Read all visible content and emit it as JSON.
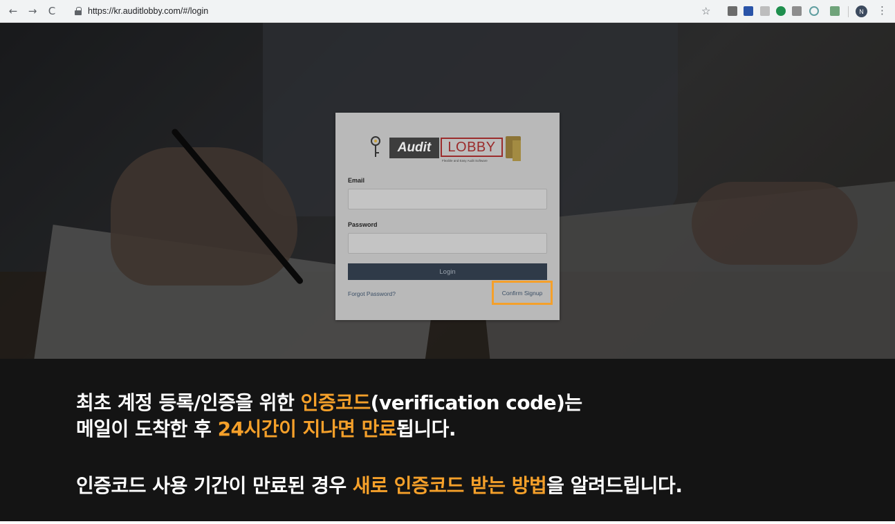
{
  "browser": {
    "back_icon": "arrow-left-icon",
    "forward_icon": "arrow-right-icon",
    "reload_icon": "reload-icon",
    "url": "https://kr.auditlobby.com/#/login",
    "profile_initial": "N"
  },
  "login": {
    "logo_audit": "Audit",
    "logo_lobby": "LOBBY",
    "logo_tagline": "Flexible and Easy Audit Software",
    "email_label": "Email",
    "password_label": "Password",
    "login_button": "Login",
    "forgot_link": "Forgot Password?",
    "confirm_link": "Confirm Signup",
    "highlight_color": "#f5a02a"
  },
  "caption": {
    "line1_a": "최초 계정 등록/인증을 위한 ",
    "line1_hl": "인증코드",
    "line1_b": "(verification code)는",
    "line2_a": "메일이 도착한 후 ",
    "line2_hl": "24시간이 지나면 만료",
    "line2_b": "됩니다.",
    "line3_a": "인증코드 사용 기간이 만료된 경우 ",
    "line3_hl": "새로 인증코드 받는 방법",
    "line3_b": "을 알려드립니다."
  }
}
